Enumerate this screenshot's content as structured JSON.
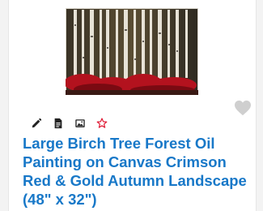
{
  "product": {
    "title": "Large Birch Tree Forest Oil Painting on Canvas Crimson Red & Gold Autumn Landscape (48\" x 32\")",
    "image_subject": "birch-forest-painting"
  },
  "toolbar": {
    "tools": [
      {
        "icon": "pencil-icon"
      },
      {
        "icon": "document-icon"
      },
      {
        "icon": "image-icon"
      },
      {
        "icon": "star-outline-icon"
      }
    ]
  },
  "favorite": {
    "icon": "heart-icon"
  },
  "colors": {
    "title": "#1878c8",
    "icon": "#222222",
    "star": "#e0203a",
    "heart": "#cfcfcf"
  }
}
